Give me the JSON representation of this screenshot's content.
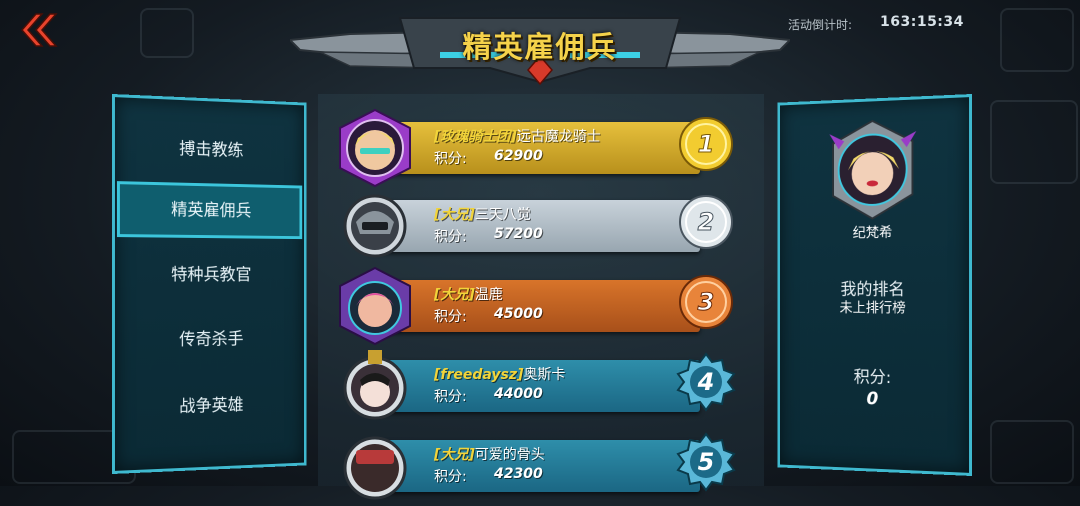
{
  "header": {
    "title": "精英雇佣兵"
  },
  "timer": {
    "label": "活动倒计时:",
    "value": "163:15:34"
  },
  "nav": {
    "items": [
      {
        "label": "搏击教练"
      },
      {
        "label": "精英雇佣兵",
        "active": true
      },
      {
        "label": "特种兵教官"
      },
      {
        "label": "传奇杀手"
      },
      {
        "label": "战争英雄"
      }
    ]
  },
  "leaderboard": {
    "score_label": "积分:",
    "entries": [
      {
        "rank": "1",
        "tag": "[玫瑰骑士团]",
        "name": "远古魔龙骑士",
        "score": "62900",
        "style": "gold"
      },
      {
        "rank": "2",
        "tag": "[大兄]",
        "name": "三天八觉",
        "score": "57200",
        "style": "silver"
      },
      {
        "rank": "3",
        "tag": "[大兄]",
        "name": "温鹿",
        "score": "45000",
        "style": "bronze"
      },
      {
        "rank": "4",
        "tag": "[freedaysz]",
        "name": "奥斯卡",
        "score": "44000",
        "style": "blue"
      },
      {
        "rank": "5",
        "tag": "[大兄]",
        "name": "可爱的骨头",
        "score": "42300",
        "style": "blue"
      }
    ]
  },
  "player": {
    "name": "纪梵希",
    "rank_label": "我的排名",
    "rank_value": "未上排行榜",
    "score_label": "积分:",
    "score_value": "0"
  },
  "colors": {
    "accent": "#3fb9cf",
    "title": "#f5d24a",
    "gold": "#e6c03c",
    "silver": "#c8d2da",
    "bronze": "#d8742a",
    "blue": "#2e8eaa"
  }
}
